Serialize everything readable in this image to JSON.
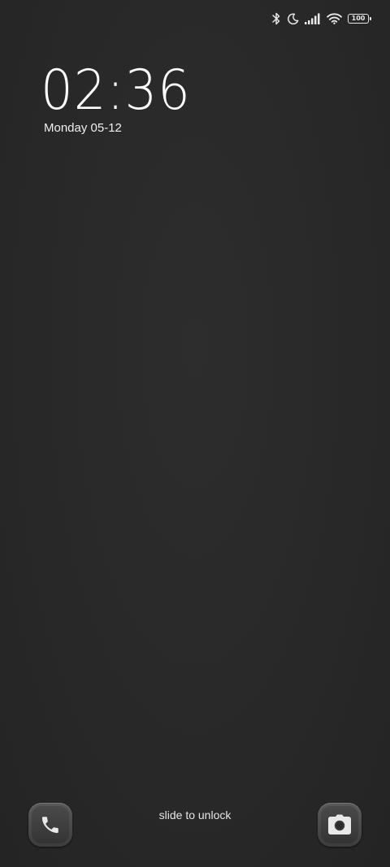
{
  "status_bar": {
    "icons": [
      "bluetooth-icon",
      "moon-icon",
      "signal-icon",
      "wifi-icon"
    ],
    "battery_level": "100"
  },
  "lock_screen": {
    "time": "02:36",
    "date": "Monday 05-12",
    "unlock_hint": "slide to unlock"
  },
  "shortcuts": {
    "left": "phone-icon",
    "right": "camera-icon"
  }
}
